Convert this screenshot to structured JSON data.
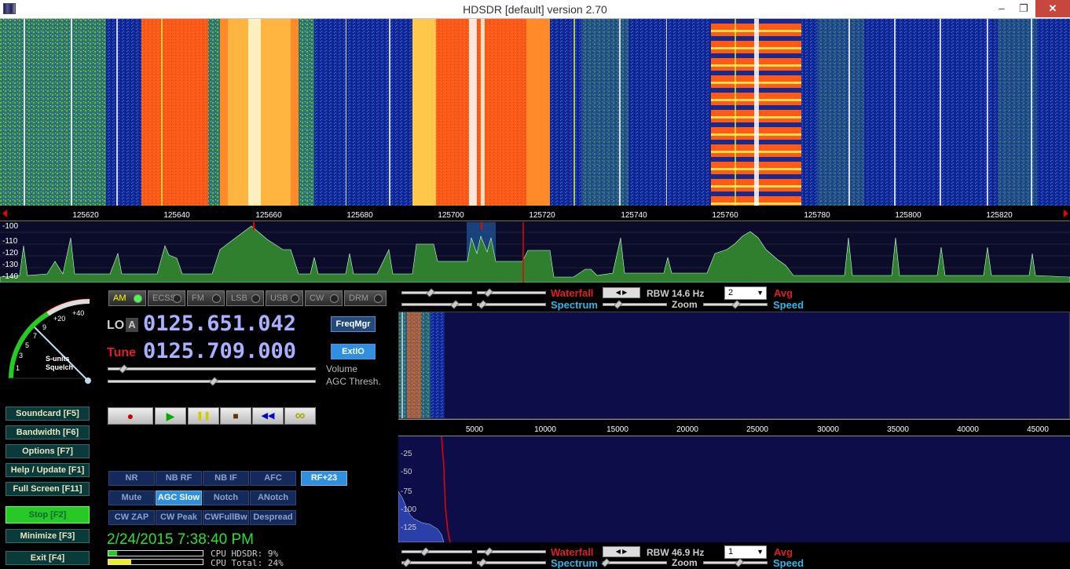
{
  "window": {
    "title": "HDSDR [default]  version 2.70",
    "minimize_glyph": "–",
    "restore_glyph": "❐",
    "close_glyph": "✕"
  },
  "rf_ruler": {
    "ticks": [
      "125620",
      "125640",
      "125660",
      "125680",
      "125700",
      "125720",
      "125740",
      "125760",
      "125780",
      "125800",
      "125820"
    ]
  },
  "rf_spectrum": {
    "db_ticks": [
      "-100",
      "-110",
      "-120",
      "-130",
      "-140"
    ]
  },
  "smeter": {
    "scale": [
      "1",
      "3",
      "5",
      "7",
      "9",
      "+20",
      "+40"
    ],
    "label1": "S-units",
    "label2": "Squelch"
  },
  "sidebar": {
    "buttons": [
      {
        "label": "Soundcard  [F5]"
      },
      {
        "label": "Bandwidth  [F6]"
      },
      {
        "label": "Options    [F7]"
      },
      {
        "label": "Help / Update  [F1]"
      },
      {
        "label": "Full Screen  [F11]"
      },
      {
        "label": "Stop            [F2]"
      },
      {
        "label": "Minimize   [F3]"
      },
      {
        "label": "Exit         [F4]"
      }
    ]
  },
  "modes": [
    "AM",
    "ECSS",
    "FM",
    "LSB",
    "USB",
    "CW",
    "DRM"
  ],
  "lo": {
    "label": "LO",
    "channel": "A",
    "freq": "0125.651.042"
  },
  "tune": {
    "label": "Tune",
    "freq": "0125.709.000"
  },
  "buttons": {
    "freqmgr": "FreqMgr",
    "extio": "ExtIO"
  },
  "sliders": {
    "volume": "Volume",
    "agc": "AGC Thresh."
  },
  "transport": {
    "record": "●",
    "play": "▶",
    "pause": "❚❚",
    "stop": "■",
    "rewind": "◀◀",
    "loop": "∞"
  },
  "dsp": {
    "row1": [
      "NR",
      "NB RF",
      "NB IF",
      "AFC",
      "RF+23"
    ],
    "row2": [
      "Mute",
      "AGC Slow",
      "Notch",
      "ANotch"
    ],
    "row3": [
      "CW ZAP",
      "CW Peak",
      "CWFullBw",
      "Despread"
    ]
  },
  "status": {
    "clock": "2/24/2015 7:38:40 PM",
    "cpu_hdsdr": "CPU HDSDR:  9%",
    "cpu_total": "CPU Total: 24%",
    "cpu_hdsdr_fill": 0.09,
    "cpu_total_fill": 0.24
  },
  "rf_controls": {
    "waterfall": "Waterfall",
    "spectrum": "Spectrum",
    "rbw": "RBW 14.6 Hz",
    "zoom": "Zoom",
    "speed": "Speed",
    "avg": "Avg",
    "avg_value": "2"
  },
  "af_controls": {
    "waterfall": "Waterfall",
    "spectrum": "Spectrum",
    "rbw": "RBW 46.9 Hz",
    "zoom": "Zoom",
    "speed": "Speed",
    "avg": "Avg",
    "avg_value": "1"
  },
  "af_ruler": {
    "ticks": [
      "5000",
      "10000",
      "15000",
      "20000",
      "25000",
      "30000",
      "35000",
      "40000",
      "45000"
    ]
  },
  "af_spectrum": {
    "db_ticks": [
      "-25",
      "-50",
      "-75",
      "-100",
      "-125"
    ]
  },
  "colors": {
    "waterfall_bg": "#0f1f8f",
    "signal_hot": "#ff5a1a",
    "spectrum_fill": "#2f7f2f",
    "accent_blue": "#2f8fe0",
    "stop_green": "#27c927",
    "tune_red": "#e02020",
    "freq_lavender": "#a9b0ff"
  }
}
